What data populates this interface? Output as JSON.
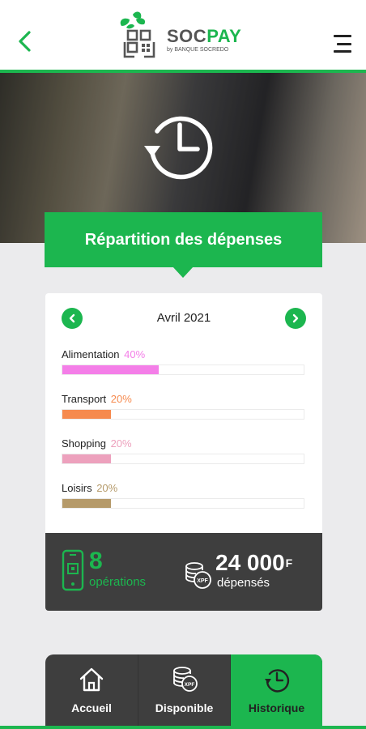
{
  "app": {
    "brand_main": "SOC",
    "brand_accent": "PAY",
    "brand_sub": "by BANQUE SOCREDO",
    "accent_color": "#1cb64f"
  },
  "header": {
    "back_icon": "chevron-left-icon",
    "menu_icon": "hamburger-menu-icon"
  },
  "page": {
    "title": "Répartition des dépenses",
    "hero_icon": "history-clock-icon"
  },
  "month_nav": {
    "label": "Avril 2021",
    "prev_icon": "chevron-left-icon",
    "next_icon": "chevron-right-icon"
  },
  "categories": [
    {
      "label": "Alimentation",
      "percent_text": "40%",
      "percent": 40,
      "color": "#f47ee8",
      "pct_color": "#f47ee8"
    },
    {
      "label": "Transport",
      "percent_text": "20%",
      "percent": 20,
      "color": "#f68a4e",
      "pct_color": "#f68a4e"
    },
    {
      "label": "Shopping",
      "percent_text": "20%",
      "percent": 20,
      "color": "#eda1bd",
      "pct_color": "#eda1bd"
    },
    {
      "label": "Loisirs",
      "percent_text": "20%",
      "percent": 20,
      "color": "#b59a6a",
      "pct_color": "#b59a6a"
    }
  ],
  "stats": {
    "operations_count": "8",
    "operations_label": "opérations",
    "amount": "24 000",
    "amount_unit": "F",
    "amount_label": "dépensés",
    "currency_badge": "XPF"
  },
  "bottom_nav": {
    "tabs": [
      {
        "label": "Accueil",
        "icon": "home-icon",
        "active": false
      },
      {
        "label": "Disponible",
        "icon": "xpf-coins-icon",
        "active": false
      },
      {
        "label": "Historique",
        "icon": "history-icon",
        "active": true
      }
    ]
  }
}
